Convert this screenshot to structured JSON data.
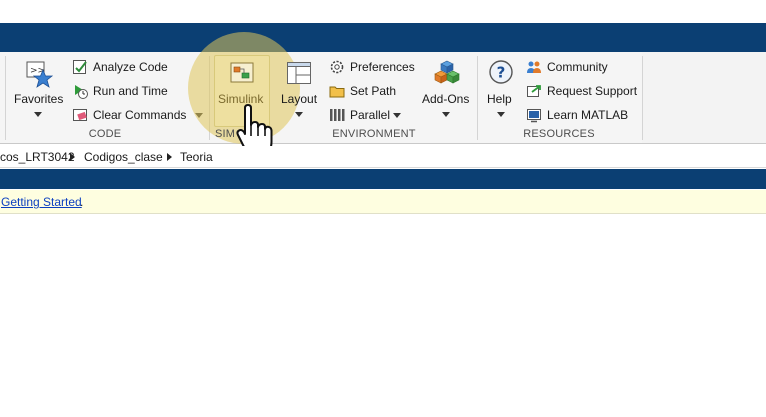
{
  "ribbon": {
    "favorites": {
      "label": "Favorites"
    },
    "code": {
      "section_label": "CODE",
      "analyze_code": "Analyze Code",
      "run_and_time": "Run and Time",
      "clear_commands": "Clear Commands"
    },
    "simulink": {
      "label": "Simulink",
      "section_label_partial": "SIM"
    },
    "environment": {
      "section_label": "ENVIRONMENT",
      "layout": "Layout",
      "preferences": "Preferences",
      "set_path": "Set Path",
      "parallel": "Parallel",
      "add_ons": "Add-Ons"
    },
    "resources": {
      "section_label": "RESOURCES",
      "help": "Help",
      "community": "Community",
      "request_support": "Request Support",
      "learn_matlab": "Learn MATLAB"
    }
  },
  "address_bar": {
    "crumbs": [
      "cos_LRT3042",
      "Codigos_clase",
      "Teoria"
    ]
  },
  "notice": {
    "link_text": "Getting Started",
    "tail_text": "."
  },
  "colors": {
    "title_band": "#0b3f73",
    "ribbon_bg": "#f5f5f5",
    "notice_bg": "#fefee0",
    "link": "#0b3fc0",
    "highlight": "#dec45a"
  }
}
